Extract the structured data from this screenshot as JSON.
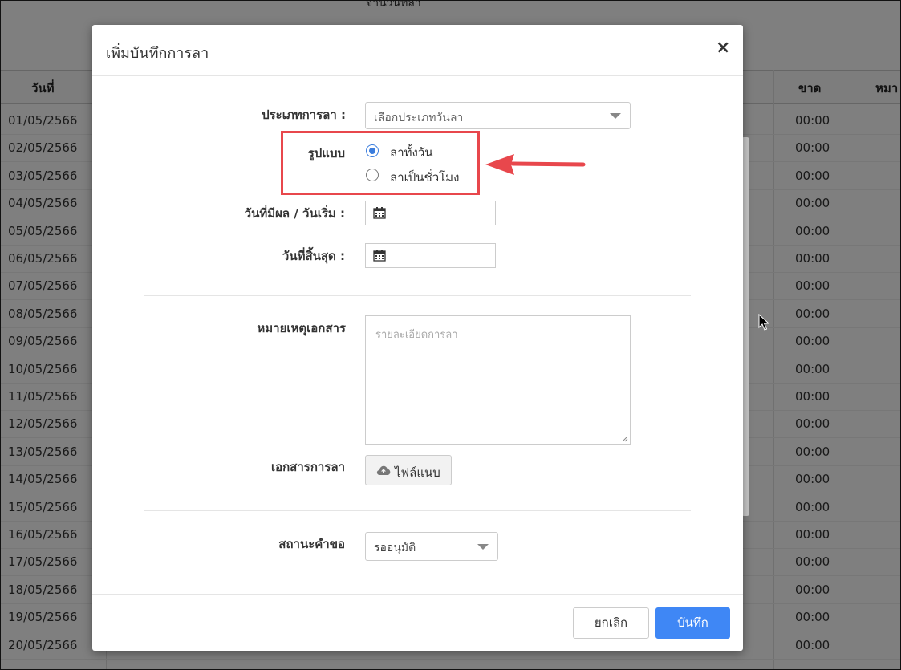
{
  "background": {
    "top_caption": "จำนวนที่ลา",
    "columns": {
      "date": "วันที่",
      "absent": "ขาด",
      "remark": "หมา"
    },
    "rows": [
      {
        "date": "01/05/2566",
        "absent": "00:00"
      },
      {
        "date": "02/05/2566",
        "absent": "00:00"
      },
      {
        "date": "03/05/2566",
        "absent": "00:00"
      },
      {
        "date": "04/05/2566",
        "absent": "00:00"
      },
      {
        "date": "05/05/2566",
        "absent": "00:00"
      },
      {
        "date": "06/05/2566",
        "absent": "00:00"
      },
      {
        "date": "07/05/2566",
        "absent": "00:00"
      },
      {
        "date": "08/05/2566",
        "absent": "00:00"
      },
      {
        "date": "09/05/2566",
        "absent": "00:00"
      },
      {
        "date": "10/05/2566",
        "absent": "00:00"
      },
      {
        "date": "11/05/2566",
        "absent": "00:00"
      },
      {
        "date": "12/05/2566",
        "absent": "00:00"
      },
      {
        "date": "13/05/2566",
        "absent": "00:00"
      },
      {
        "date": "14/05/2566",
        "absent": "00:00"
      },
      {
        "date": "15/05/2566",
        "absent": "00:00"
      },
      {
        "date": "16/05/2566",
        "absent": "00:00"
      },
      {
        "date": "17/05/2566",
        "absent": "00:00"
      },
      {
        "date": "18/05/2566",
        "absent": "00:00"
      },
      {
        "date": "19/05/2566",
        "absent": "00:00"
      },
      {
        "date": "20/05/2566",
        "absent": "00:00"
      }
    ]
  },
  "modal": {
    "title": "เพิ่มบันทึกการลา",
    "close_label": "×",
    "leave_type": {
      "label": "ประเภทการลา :",
      "value": "เลือกประเภทวันลา"
    },
    "format": {
      "label": "รูปแบบ",
      "options": [
        {
          "label": "ลาทั้งวัน",
          "selected": true
        },
        {
          "label": "ลาเป็นชั่วโมง",
          "selected": false
        }
      ]
    },
    "start_date": {
      "label": "วันที่มีผล / วันเริ่ม :",
      "value": ""
    },
    "end_date": {
      "label": "วันที่สิ้นสุด :",
      "value": ""
    },
    "remark": {
      "label": "หมายเหตุเอกสาร",
      "placeholder": "รายละเอียดการลา"
    },
    "attachment": {
      "label": "เอกสารการลา",
      "button_label": "ไฟล์แนบ"
    },
    "status": {
      "label": "สถานะคำขอ",
      "value": "รออนุมัติ"
    },
    "cancel_label": "ยกเลิก",
    "save_label": "บันทึก"
  },
  "colors": {
    "accent": "#3f87f5",
    "highlight": "#e8474c",
    "radio": "#3b7ddd"
  }
}
